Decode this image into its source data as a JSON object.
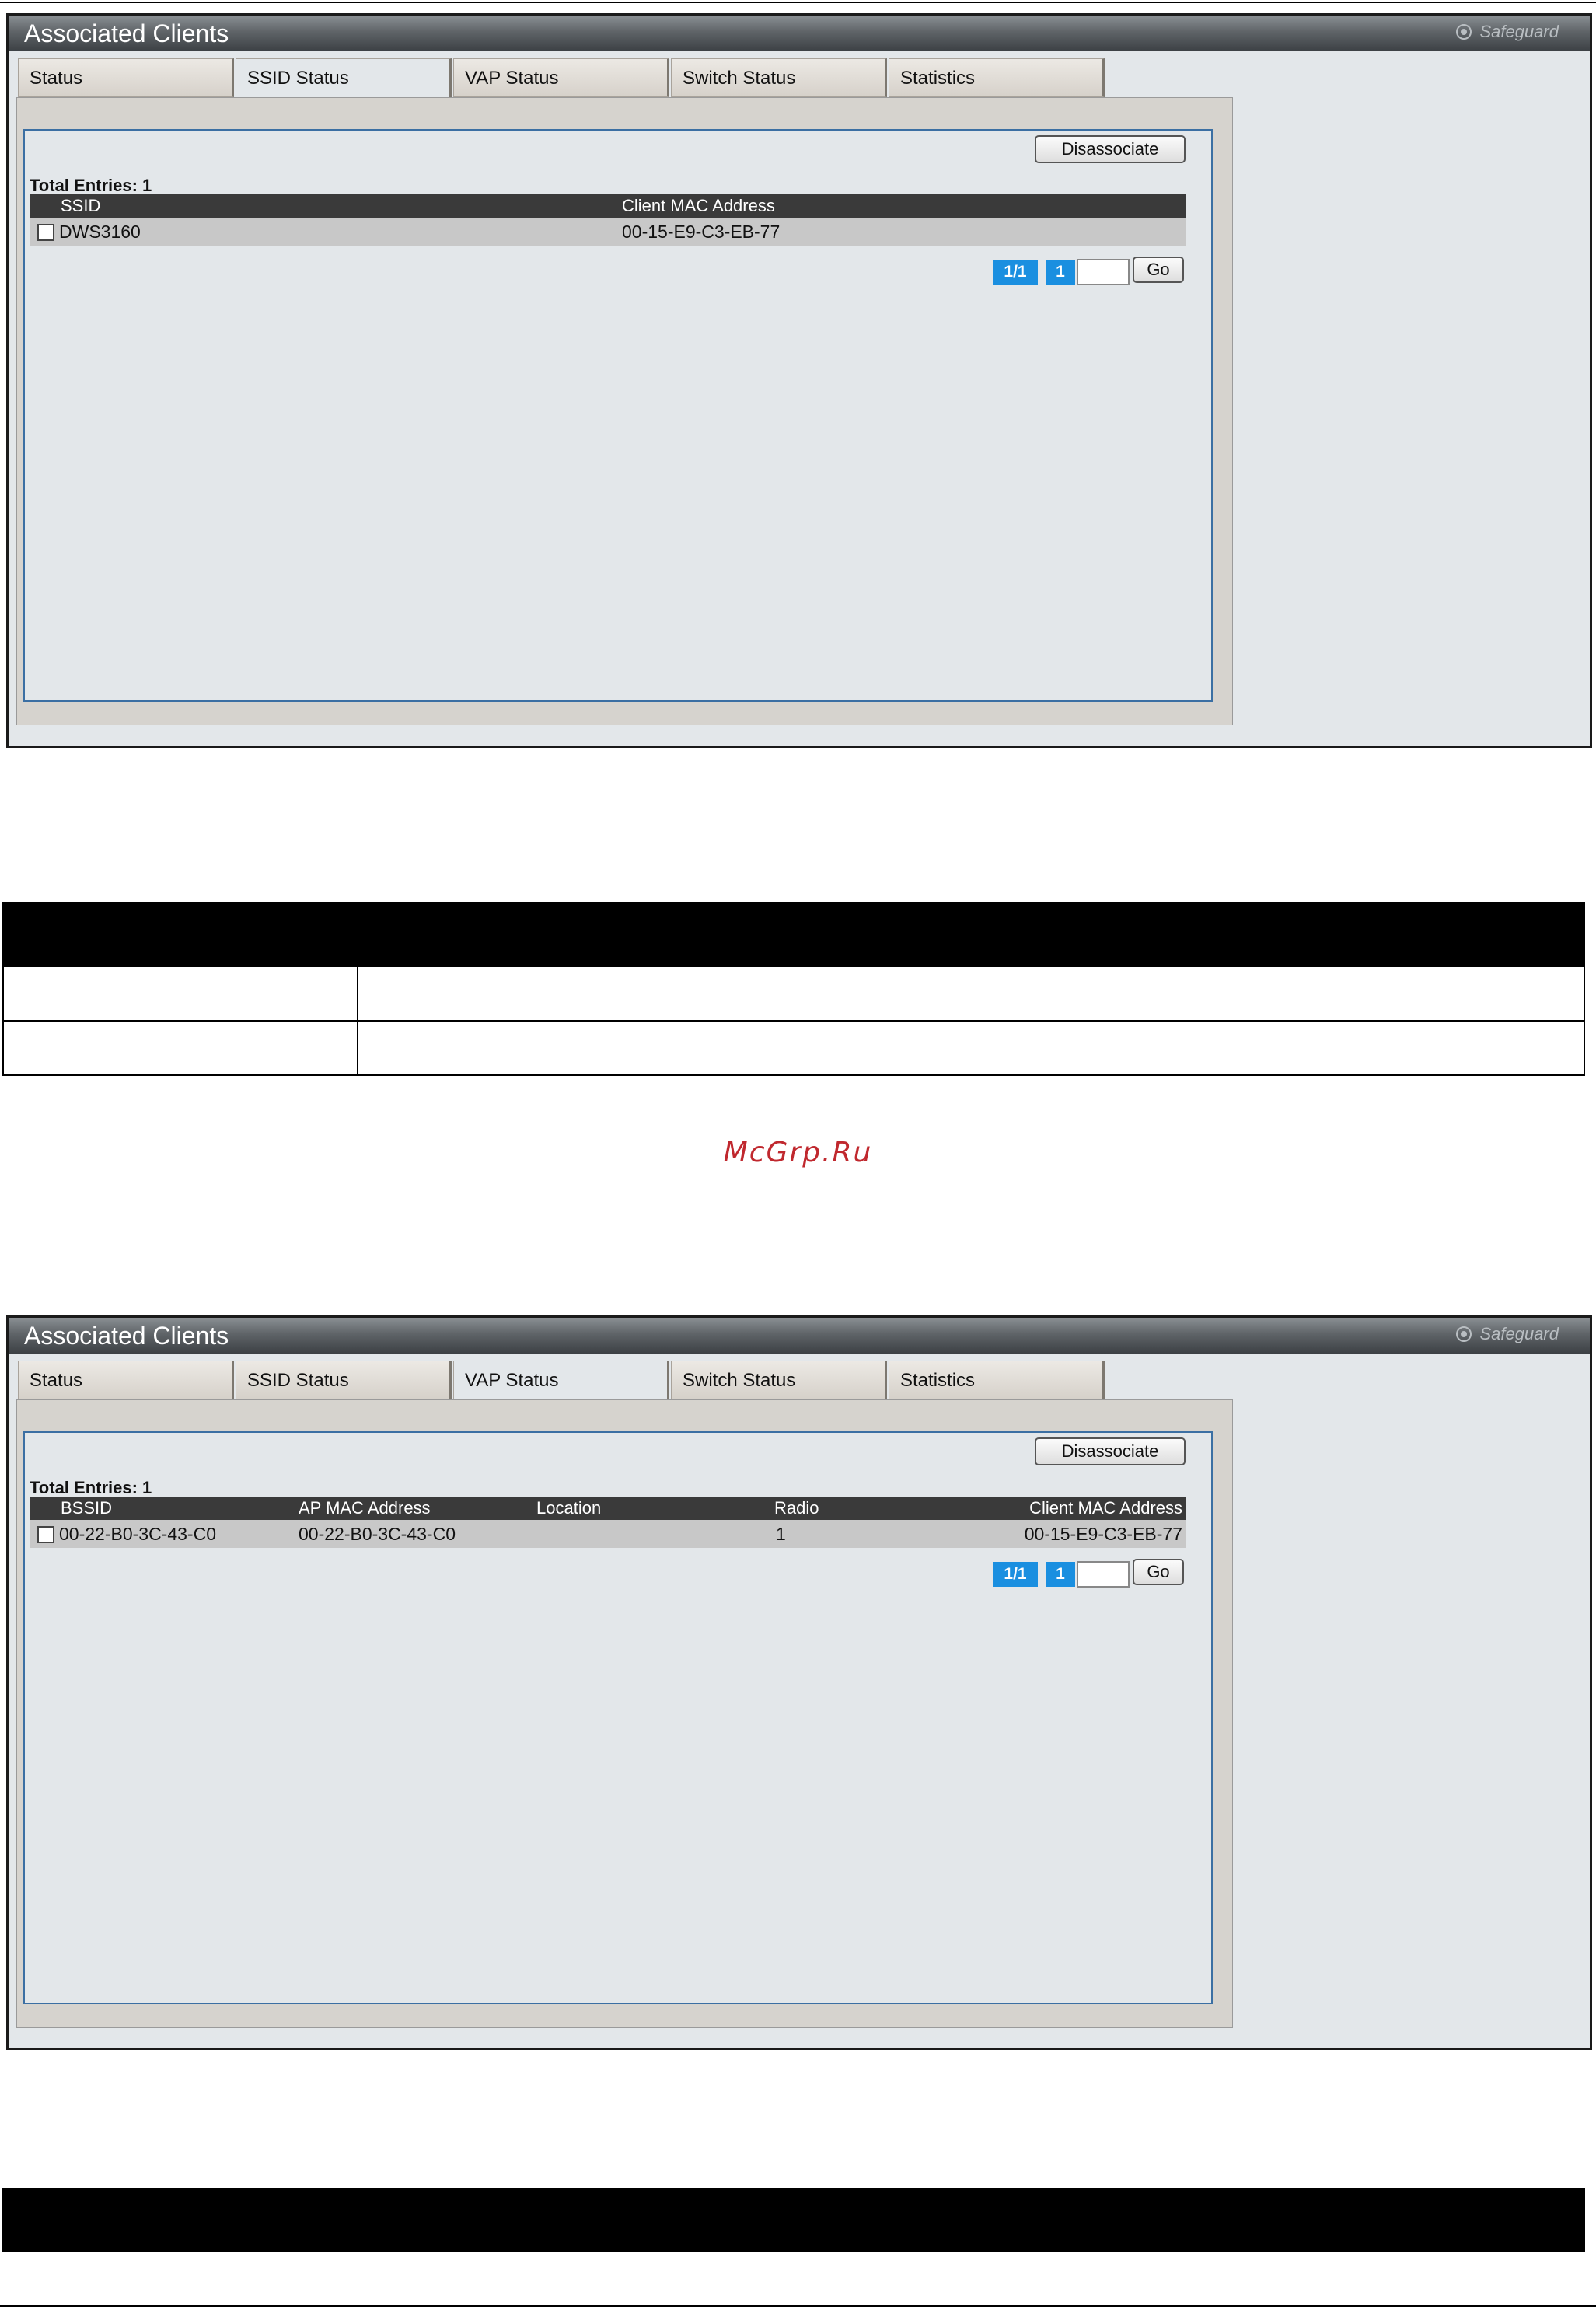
{
  "screen1": {
    "title": "Associated Clients",
    "safeguard_label": "Safeguard",
    "tabs": [
      {
        "label": "Status"
      },
      {
        "label": "SSID Status",
        "active": true
      },
      {
        "label": "VAP Status"
      },
      {
        "label": "Switch Status"
      },
      {
        "label": "Statistics"
      }
    ],
    "disassociate_label": "Disassociate",
    "total_entries": "Total Entries: 1",
    "columns": [
      "SSID",
      "Client MAC Address"
    ],
    "rows": [
      {
        "ssid": "DWS3160",
        "client_mac": "00-15-E9-C3-EB-77",
        "checked": false
      }
    ],
    "pagination": {
      "page_of": "1/1",
      "current_page": "1",
      "go_label": "Go",
      "page_input": ""
    }
  },
  "screen2": {
    "title": "Associated Clients",
    "safeguard_label": "Safeguard",
    "tabs": [
      {
        "label": "Status"
      },
      {
        "label": "SSID Status"
      },
      {
        "label": "VAP Status",
        "active": true
      },
      {
        "label": "Switch Status"
      },
      {
        "label": "Statistics"
      }
    ],
    "disassociate_label": "Disassociate",
    "total_entries": "Total Entries: 1",
    "columns": [
      "BSSID",
      "AP MAC Address",
      "Location",
      "Radio",
      "Client MAC Address"
    ],
    "rows": [
      {
        "bssid": "00-22-B0-3C-43-C0",
        "ap_mac": "00-22-B0-3C-43-C0",
        "location": "",
        "radio": "1",
        "client_mac": "00-15-E9-C3-EB-77",
        "checked": false
      }
    ],
    "pagination": {
      "page_of": "1/1",
      "current_page": "1",
      "go_label": "Go",
      "page_input": ""
    }
  },
  "watermark": "McGrp.Ru"
}
